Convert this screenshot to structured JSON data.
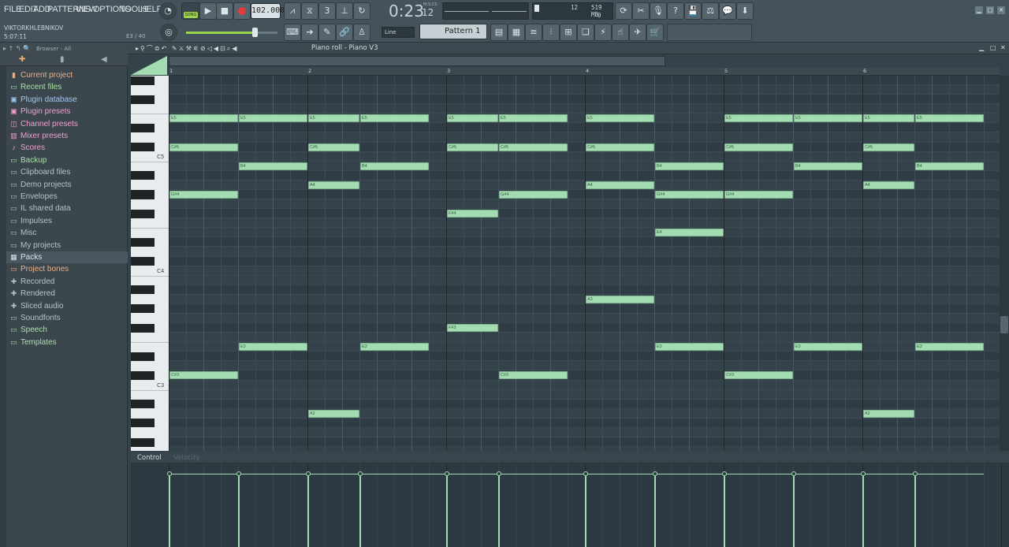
{
  "menu": [
    "FILE",
    "EDIT",
    "ADD",
    "PATTERNS",
    "VIEW",
    "OPTIONS",
    "TOOLS",
    "HELP"
  ],
  "transport": {
    "song_label": "SONG",
    "tempo": "102.000",
    "time": "0:23",
    "time_sub": "12",
    "time_unit": "M:S:CS",
    "cpu": "12",
    "mem": "519 MB",
    "poly": "0"
  },
  "project": {
    "user": "VIKTORKHLEBNIKOV",
    "elapsed": "5:07:11",
    "hint": "E3 / 40"
  },
  "toolbar2": {
    "snap": "Line",
    "pattern": "Pattern 1"
  },
  "browser": {
    "title": "Browser - All",
    "items": [
      {
        "label": "Current project",
        "color": "#e8b08a",
        "icon": "project-icon"
      },
      {
        "label": "Recent files",
        "color": "#a8e0a8",
        "icon": "folder-icon"
      },
      {
        "label": "Plugin database",
        "color": "#9fc8f0",
        "icon": "plugin-icon"
      },
      {
        "label": "Plugin presets",
        "color": "#f0a0d0",
        "icon": "plugin-icon"
      },
      {
        "label": "Channel presets",
        "color": "#f0a0d0",
        "icon": "channel-icon"
      },
      {
        "label": "Mixer presets",
        "color": "#f0a0d0",
        "icon": "mixer-icon"
      },
      {
        "label": "Scores",
        "color": "#f0a0d0",
        "icon": "note-icon"
      },
      {
        "label": "Backup",
        "color": "#a8e0a8",
        "icon": "folder-icon"
      },
      {
        "label": "Clipboard files",
        "color": "#b7c3c9",
        "icon": "folder-icon"
      },
      {
        "label": "Demo projects",
        "color": "#b7c3c9",
        "icon": "folder-icon"
      },
      {
        "label": "Envelopes",
        "color": "#b7c3c9",
        "icon": "folder-icon"
      },
      {
        "label": "IL shared data",
        "color": "#b7c3c9",
        "icon": "folder-icon"
      },
      {
        "label": "Impulses",
        "color": "#b7c3c9",
        "icon": "folder-icon"
      },
      {
        "label": "Misc",
        "color": "#b7c3c9",
        "icon": "folder-icon"
      },
      {
        "label": "My projects",
        "color": "#b7c3c9",
        "icon": "folder-icon"
      },
      {
        "label": "Packs",
        "color": "#d8e4ea",
        "icon": "packs-icon"
      },
      {
        "label": "Project bones",
        "color": "#e8b08a",
        "icon": "folder-icon"
      },
      {
        "label": "Recorded",
        "color": "#b7c3c9",
        "icon": "record-icon"
      },
      {
        "label": "Rendered",
        "color": "#b7c3c9",
        "icon": "render-icon"
      },
      {
        "label": "Sliced audio",
        "color": "#b7c3c9",
        "icon": "slice-icon"
      },
      {
        "label": "Soundfonts",
        "color": "#b7c3c9",
        "icon": "folder-icon"
      },
      {
        "label": "Speech",
        "color": "#a8e0a8",
        "icon": "folder-icon"
      },
      {
        "label": "Templates",
        "color": "#a8e0a8",
        "icon": "folder-icon"
      }
    ]
  },
  "pianoroll": {
    "title": "Piano roll - Piano V3",
    "bars": [
      "1",
      "2",
      "3",
      "4",
      "5",
      "6"
    ],
    "key_labels": [
      "C5",
      "C4",
      "C3"
    ],
    "notes": [
      {
        "name": "E5",
        "bar": 1,
        "start": 0,
        "len": 4
      },
      {
        "name": "E5",
        "bar": 1,
        "start": 4,
        "len": 4
      },
      {
        "name": "E5",
        "bar": 2,
        "start": 0,
        "len": 3
      },
      {
        "name": "E5",
        "bar": 2,
        "start": 3,
        "len": 4
      },
      {
        "name": "E5",
        "bar": 3,
        "start": 0,
        "len": 3
      },
      {
        "name": "E5",
        "bar": 3,
        "start": 3,
        "len": 4
      },
      {
        "name": "E5",
        "bar": 4,
        "start": 0,
        "len": 4
      },
      {
        "name": "E5",
        "bar": 5,
        "start": 0,
        "len": 4
      },
      {
        "name": "E5",
        "bar": 5,
        "start": 4,
        "len": 4
      },
      {
        "name": "E5",
        "bar": 6,
        "start": 0,
        "len": 3
      },
      {
        "name": "E5",
        "bar": 6,
        "start": 3,
        "len": 4
      },
      {
        "name": "C#5",
        "bar": 1,
        "start": 0,
        "len": 4
      },
      {
        "name": "C#5",
        "bar": 2,
        "start": 0,
        "len": 3
      },
      {
        "name": "C#5",
        "bar": 3,
        "start": 0,
        "len": 3
      },
      {
        "name": "C#5",
        "bar": 3,
        "start": 3,
        "len": 4
      },
      {
        "name": "C#5",
        "bar": 4,
        "start": 0,
        "len": 4
      },
      {
        "name": "C#5",
        "bar": 5,
        "start": 0,
        "len": 4
      },
      {
        "name": "C#5",
        "bar": 6,
        "start": 0,
        "len": 3
      },
      {
        "name": "B4",
        "bar": 1,
        "start": 4,
        "len": 4
      },
      {
        "name": "B4",
        "bar": 2,
        "start": 3,
        "len": 4
      },
      {
        "name": "B4",
        "bar": 4,
        "start": 4,
        "len": 4
      },
      {
        "name": "B4",
        "bar": 5,
        "start": 4,
        "len": 4
      },
      {
        "name": "B4",
        "bar": 6,
        "start": 3,
        "len": 4
      },
      {
        "name": "A4",
        "bar": 2,
        "start": 0,
        "len": 3
      },
      {
        "name": "A4",
        "bar": 4,
        "start": 0,
        "len": 4
      },
      {
        "name": "A4",
        "bar": 6,
        "start": 0,
        "len": 3
      },
      {
        "name": "G#4",
        "bar": 1,
        "start": 0,
        "len": 4
      },
      {
        "name": "G#4",
        "bar": 3,
        "start": 3,
        "len": 4
      },
      {
        "name": "G#4",
        "bar": 4,
        "start": 4,
        "len": 4
      },
      {
        "name": "G#4",
        "bar": 5,
        "start": 0,
        "len": 4
      },
      {
        "name": "F#4",
        "bar": 3,
        "start": 0,
        "len": 3
      },
      {
        "name": "E4",
        "bar": 4,
        "start": 4,
        "len": 4
      },
      {
        "name": "A3",
        "bar": 4,
        "start": 0,
        "len": 4
      },
      {
        "name": "F#3",
        "bar": 3,
        "start": 0,
        "len": 3
      },
      {
        "name": "E3",
        "bar": 1,
        "start": 4,
        "len": 4
      },
      {
        "name": "E3",
        "bar": 2,
        "start": 3,
        "len": 4
      },
      {
        "name": "E3",
        "bar": 4,
        "start": 4,
        "len": 4
      },
      {
        "name": "E3",
        "bar": 5,
        "start": 4,
        "len": 4
      },
      {
        "name": "E3",
        "bar": 6,
        "start": 3,
        "len": 4
      },
      {
        "name": "C#3",
        "bar": 1,
        "start": 0,
        "len": 4
      },
      {
        "name": "C#3",
        "bar": 3,
        "start": 3,
        "len": 4
      },
      {
        "name": "C#3",
        "bar": 5,
        "start": 0,
        "len": 4
      },
      {
        "name": "A2",
        "bar": 2,
        "start": 0,
        "len": 3
      },
      {
        "name": "A2",
        "bar": 6,
        "start": 0,
        "len": 3
      }
    ],
    "control": {
      "label": "Control",
      "target": "Velocity"
    }
  },
  "colors": {
    "note_fill": "#a3dcb0",
    "note_border": "#7cb38a",
    "grid_bg": "#34424a",
    "grid_line": "#3f4e56",
    "bar_line": "#56666f"
  }
}
